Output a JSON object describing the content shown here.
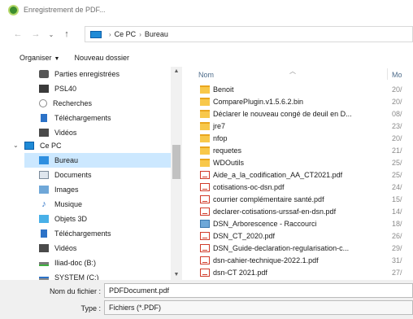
{
  "window": {
    "title": "Enregistrement de PDF..."
  },
  "address": {
    "crumbs": [
      "Ce PC",
      "Bureau"
    ]
  },
  "toolbar": {
    "organize_label": "Organiser",
    "new_folder_label": "Nouveau dossier"
  },
  "nav": {
    "items": [
      {
        "label": "Parties enregistrées",
        "icon": "network-share-icon"
      },
      {
        "label": "PSL40",
        "icon": "folder-dark-icon"
      },
      {
        "label": "Recherches",
        "icon": "search-icon"
      },
      {
        "label": "Téléchargements",
        "icon": "download-icon"
      },
      {
        "label": "Vidéos",
        "icon": "video-icon"
      },
      {
        "label": "Ce PC",
        "icon": "computer-icon"
      },
      {
        "label": "Bureau",
        "icon": "desktop-icon",
        "selected": true
      },
      {
        "label": "Documents",
        "icon": "documents-icon"
      },
      {
        "label": "Images",
        "icon": "images-icon"
      },
      {
        "label": "Musique",
        "icon": "music-icon"
      },
      {
        "label": "Objets 3D",
        "icon": "objects-3d-icon"
      },
      {
        "label": "Téléchargements",
        "icon": "download-icon"
      },
      {
        "label": "Vidéos",
        "icon": "video-icon"
      },
      {
        "label": "Iliad-doc (B:)",
        "icon": "network-drive-icon"
      },
      {
        "label": "SYSTEM (C:)",
        "icon": "drive-icon"
      }
    ]
  },
  "files": {
    "header": {
      "name": "Nom",
      "date": "Mo"
    },
    "rows": [
      {
        "name": "Benoit",
        "type": "folder",
        "date": "20/"
      },
      {
        "name": "ComparePlugin.v1.5.6.2.bin",
        "type": "folder",
        "date": "20/"
      },
      {
        "name": "Déclarer le nouveau congé de deuil en D...",
        "type": "folder",
        "date": "08/"
      },
      {
        "name": "jre7",
        "type": "folder",
        "date": "23/"
      },
      {
        "name": "nfop",
        "type": "folder",
        "date": "20/"
      },
      {
        "name": "requetes",
        "type": "folder",
        "date": "21/"
      },
      {
        "name": "WDOutils",
        "type": "folder",
        "date": "25/"
      },
      {
        "name": "Aide_a_la_codification_AA_CT2021.pdf",
        "type": "pdf",
        "date": "25/"
      },
      {
        "name": "cotisations-oc-dsn.pdf",
        "type": "pdf",
        "date": "24/"
      },
      {
        "name": "courrier complémentaire santé.pdf",
        "type": "pdf",
        "date": "15/"
      },
      {
        "name": "declarer-cotisations-urssaf-en-dsn.pdf",
        "type": "pdf",
        "date": "14/"
      },
      {
        "name": "DSN_Arborescence - Raccourci",
        "type": "shortcut",
        "date": "18/"
      },
      {
        "name": "DSN_CT_2020.pdf",
        "type": "pdf",
        "date": "26/"
      },
      {
        "name": "DSN_Guide-declaration-regularisation-c...",
        "type": "pdf",
        "date": "29/"
      },
      {
        "name": "dsn-cahier-technique-2022.1.pdf",
        "type": "pdf",
        "date": "31/"
      },
      {
        "name": "dsn-CT 2021.pdf",
        "type": "pdf",
        "date": "27/"
      }
    ]
  },
  "footer": {
    "filename_label": "Nom du fichier :",
    "filename_value": "PDFDocument.pdf",
    "type_label": "Type :",
    "type_value": "Fichiers (*.PDF)"
  }
}
